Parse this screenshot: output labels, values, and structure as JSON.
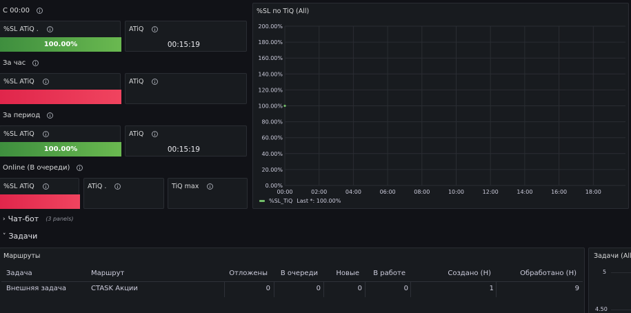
{
  "rows": {
    "since_midnight": "С 00:00",
    "per_hour": "За час",
    "per_period": "За период",
    "online": "Online (В очереди)"
  },
  "panels": {
    "sl_atiq_dot": "%SL ATiQ .",
    "sl_atiq": "%SL ATiQ",
    "atiq": "ATiQ",
    "atiq_dot": "ATiQ .",
    "tiq_max": "TiQ max",
    "value_100": "100.00%",
    "time_val": "00:15:19"
  },
  "chart_panel": {
    "title": "%SL по TiQ (All)",
    "legend_name": "%SL_TiQ",
    "legend_last": "Last *: 100.00%"
  },
  "chart_data": {
    "type": "line",
    "title": "%SL по TiQ (All)",
    "y_ticks": [
      "200.00%",
      "180.00%",
      "160.00%",
      "140.00%",
      "120.00%",
      "100.00%",
      "80.00%",
      "60.00%",
      "40.00%",
      "20.00%",
      "0.00%"
    ],
    "x_ticks": [
      "00:00",
      "02:00",
      "04:00",
      "06:00",
      "08:00",
      "10:00",
      "12:00",
      "14:00",
      "16:00",
      "18:00"
    ],
    "ylim": [
      0,
      200
    ],
    "series": [
      {
        "name": "%SL_TiQ",
        "color": "#73bf69",
        "x": [
          "00:00"
        ],
        "values": [
          100
        ]
      }
    ],
    "grid": true,
    "legend": "bottom-left"
  },
  "sections": {
    "chatbot": "Чат-бот",
    "chatbot_count": "(3 panels)",
    "tasks": "Задачи"
  },
  "routes_panel": {
    "title": "Маршруты",
    "columns": [
      "Задача",
      "Маршрут",
      "Отложены",
      "В очереди",
      "Новые",
      "В работе",
      "Создано (Н)",
      "Обработано (Н)"
    ],
    "rows": [
      [
        "Внешняя задача",
        "CTASK Акции",
        "0",
        "0",
        "0",
        "0",
        "1",
        "9"
      ]
    ]
  },
  "tasks_panel": {
    "title": "Задачи (All)",
    "y_top": "5",
    "y_bottom": "4.50"
  },
  "colors": {
    "green": "#73bf69",
    "red": "#f2495c",
    "panel_bg": "#181b1f",
    "page_bg": "#111217"
  }
}
